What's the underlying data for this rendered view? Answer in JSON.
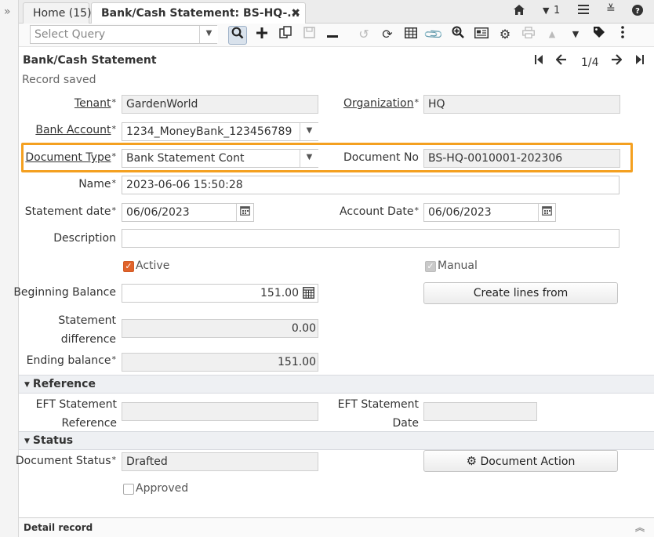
{
  "tabs": {
    "home_label": "Home (15)",
    "active_label": "Bank/Cash Statement: BS-HQ-...",
    "close_glyph": "✖",
    "window_count": "1"
  },
  "toolbar": {
    "query_placeholder": "Select Query"
  },
  "form": {
    "title": "Bank/Cash Statement",
    "record_position": "1/4",
    "status_message": "Record saved"
  },
  "fields": {
    "tenant": {
      "label": "Tenant",
      "value": "GardenWorld"
    },
    "organization": {
      "label": "Organization",
      "value": "HQ"
    },
    "bank_account": {
      "label": "Bank Account",
      "value": "1234_MoneyBank_123456789"
    },
    "document_type": {
      "label": "Document Type",
      "value": "Bank Statement Cont"
    },
    "document_no": {
      "label": "Document No",
      "value": "BS-HQ-0010001-202306"
    },
    "name": {
      "label": "Name",
      "value": "2023-06-06 15:50:28"
    },
    "statement_date": {
      "label": "Statement date",
      "value": "06/06/2023"
    },
    "account_date": {
      "label": "Account Date",
      "value": "06/06/2023"
    },
    "description": {
      "label": "Description",
      "value": ""
    },
    "active": {
      "label": "Active",
      "checked": true
    },
    "manual": {
      "label": "Manual",
      "checked": true
    },
    "beginning_balance": {
      "label": "Beginning Balance",
      "value": "151.00"
    },
    "create_lines_from": {
      "label": "Create lines from"
    },
    "statement_difference": {
      "label_line1": "Statement",
      "label_line2": "difference",
      "value": "0.00"
    },
    "ending_balance": {
      "label": "Ending balance",
      "value": "151.00"
    }
  },
  "reference_section": {
    "title": "Reference",
    "eft_statement_reference": {
      "label_line1": "EFT Statement",
      "label_line2": "Reference",
      "value": ""
    },
    "eft_statement_date": {
      "label_line1": "EFT Statement",
      "label_line2": "Date",
      "value": ""
    }
  },
  "status_section": {
    "title": "Status",
    "document_status": {
      "label": "Document Status",
      "value": "Drafted"
    },
    "document_action": {
      "label": "Document Action"
    },
    "approved": {
      "label": "Approved",
      "checked": false
    }
  },
  "detail": {
    "label": "Detail record"
  },
  "colors": {
    "highlight": "#f4a020",
    "checkbox_on": "#e0632b"
  }
}
